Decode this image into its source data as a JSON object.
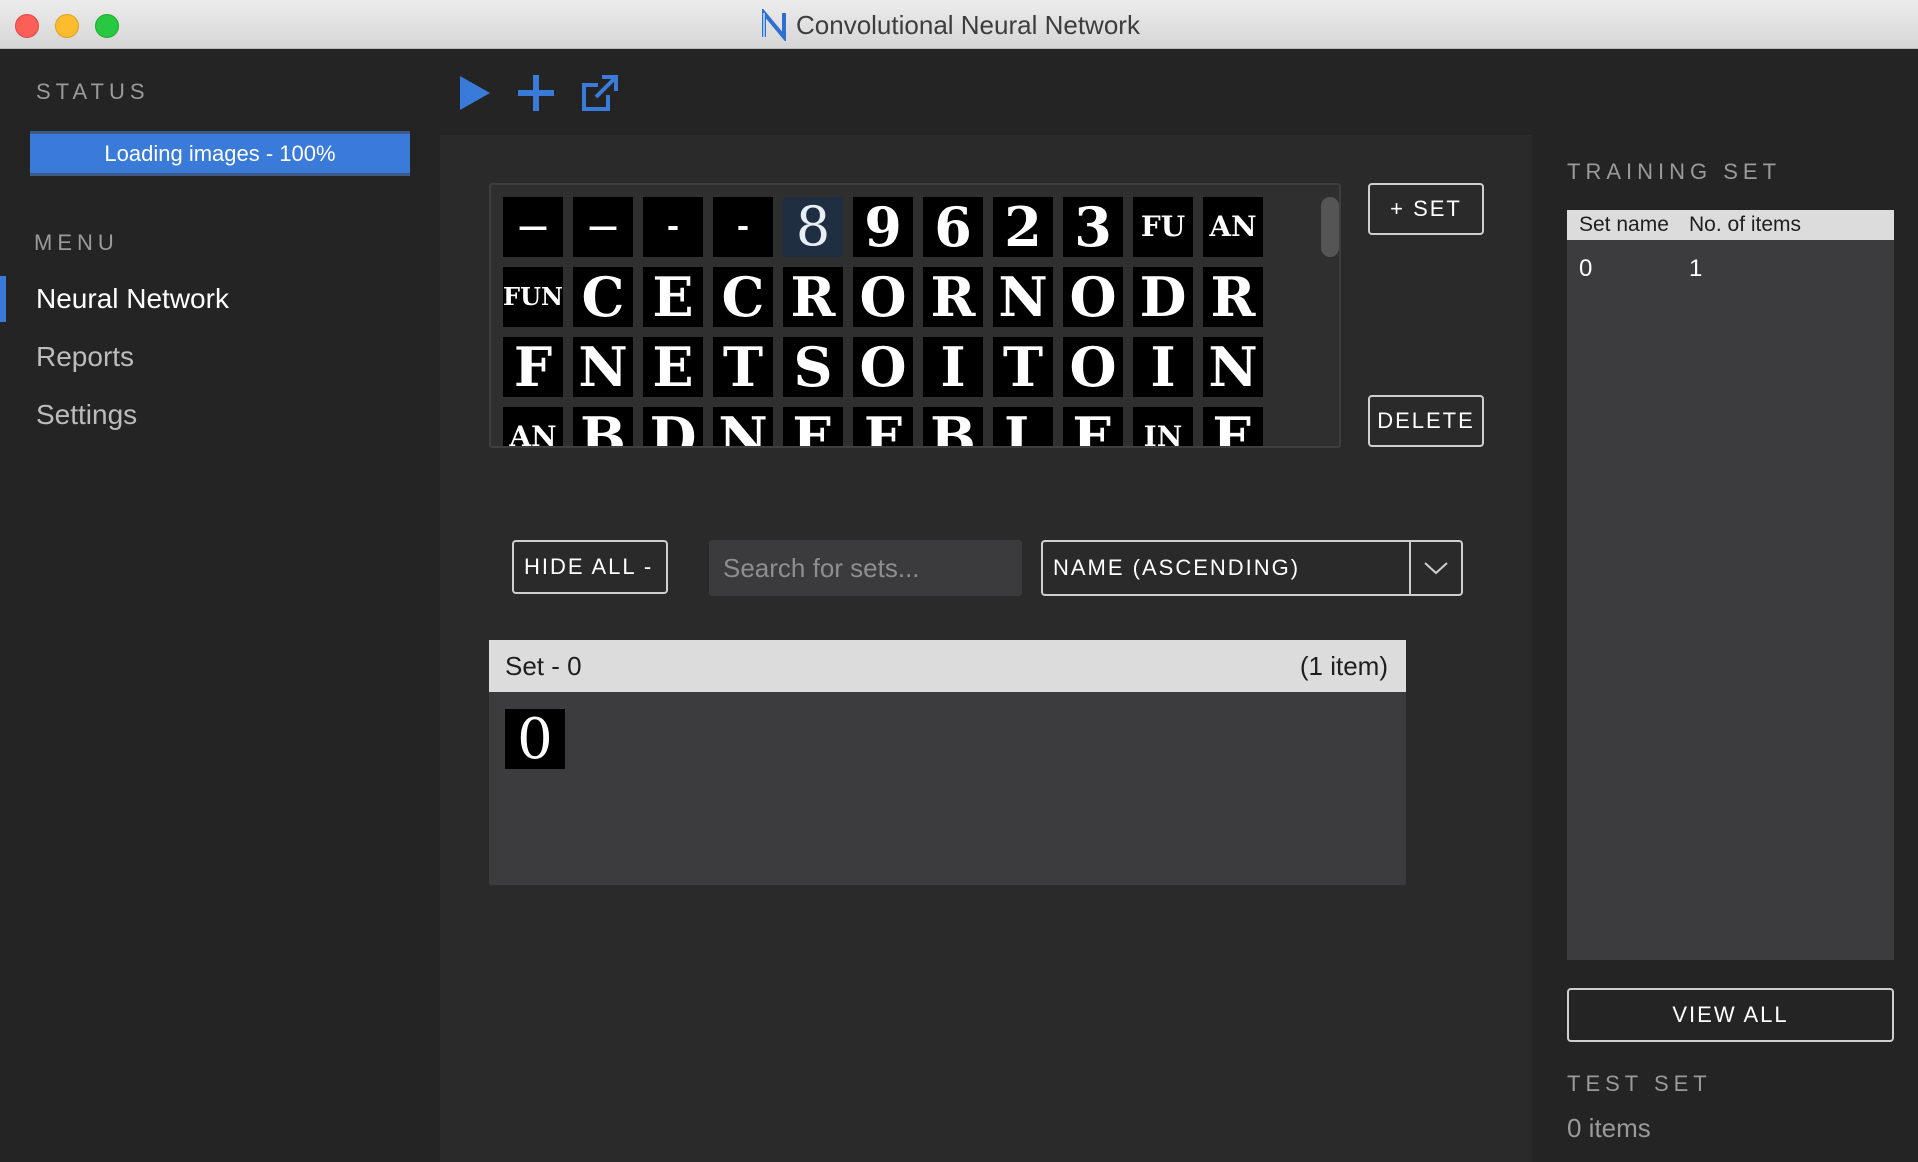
{
  "window": {
    "title": "Convolutional Neural Network"
  },
  "sidebar": {
    "status_label": "STATUS",
    "progress": {
      "text": "Loading images - 100%",
      "percent": 100
    },
    "menu_label": "MENU",
    "items": [
      {
        "label": "Neural Network",
        "active": true
      },
      {
        "label": "Reports",
        "active": false
      },
      {
        "label": "Settings",
        "active": false
      }
    ]
  },
  "toolbar": {
    "icons": [
      "play-icon",
      "plus-icon",
      "external-link-icon"
    ]
  },
  "image_grid": {
    "rows": [
      [
        "—",
        "—",
        "-",
        "-",
        "8",
        "9",
        "6",
        "2",
        "3",
        "FU",
        "AN"
      ],
      [
        "FUN",
        "C",
        "E",
        "C",
        "R",
        "O",
        "R",
        "N",
        "O",
        "D",
        "R"
      ],
      [
        "F",
        "N",
        "E",
        "T",
        "S",
        "O",
        "I",
        "T",
        "O",
        "I",
        "N"
      ],
      [
        "AN",
        "B",
        "D",
        "N",
        "E",
        "F",
        "B",
        "L",
        "E",
        "IN",
        "E"
      ]
    ]
  },
  "actions": {
    "add_set": "+ SET",
    "delete": "DELETE",
    "hide_all": "HIDE ALL -",
    "search_placeholder": "Search for sets...",
    "sort_value": "NAME (ASCENDING)"
  },
  "set_card": {
    "title": "Set - 0",
    "count": "(1 item)",
    "thumbnail": "0"
  },
  "training_set": {
    "label": "TRAINING SET",
    "columns": [
      "Set name",
      "No. of items"
    ],
    "rows": [
      {
        "name": "0",
        "count": "1"
      }
    ],
    "view_all": "VIEW ALL"
  },
  "test_set": {
    "label": "TEST SET",
    "count_text": "0 items"
  },
  "colors": {
    "accent": "#3a7ad9",
    "background": "#242424",
    "panel": "#2a2a2b"
  }
}
